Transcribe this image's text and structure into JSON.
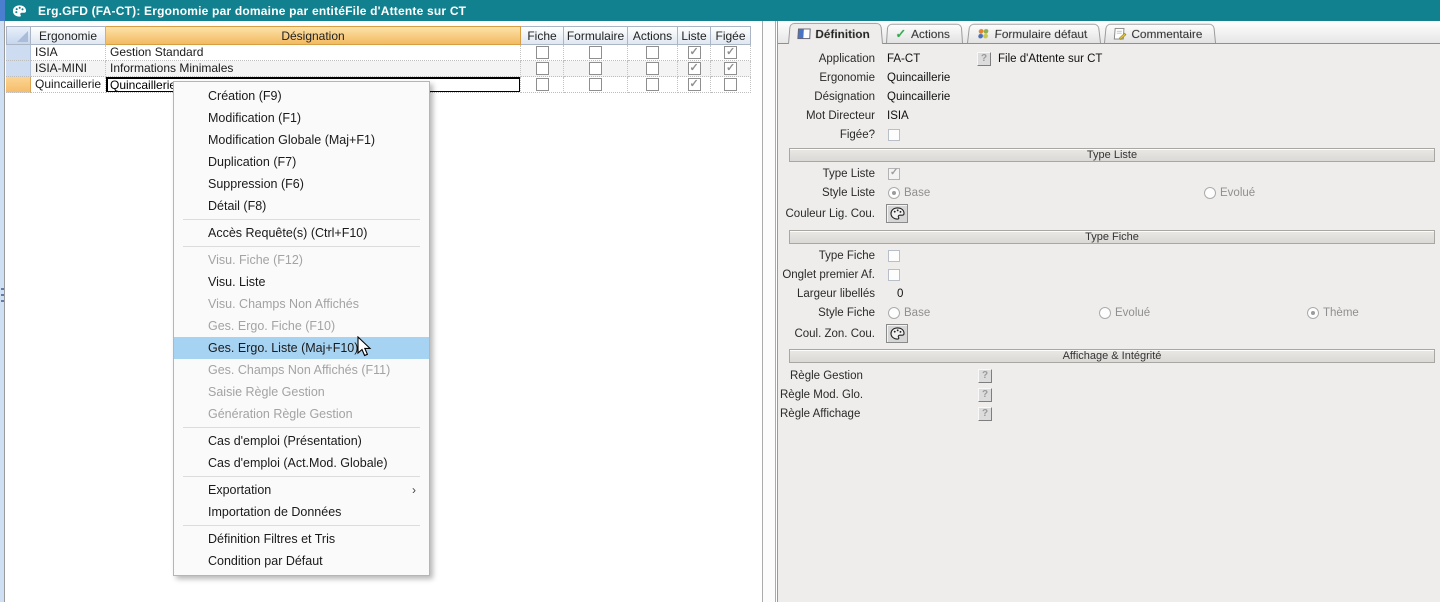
{
  "window": {
    "title": "Erg.GFD (FA-CT): Ergonomie par domaine par entitéFile d'Attente sur CT"
  },
  "colors": {
    "titlebar_teal": "#12818f",
    "sort_header_orange": "#f2ba62",
    "selector_blue": "#cddcf1",
    "current_row_orange": "#f5bd6b",
    "menu_highlight_blue": "#a7d3f2",
    "check_gray": "#8f8f8f",
    "actions_tab_check_green": "#2fa64b"
  },
  "table": {
    "headers": [
      "Ergonomie",
      "Désignation",
      "Fiche",
      "Formulaire",
      "Actions",
      "Liste",
      "Figée"
    ],
    "rows": [
      {
        "ergonomie": "ISIA",
        "designation": "Gestion Standard",
        "checks": [
          false,
          false,
          false,
          true,
          true
        ]
      },
      {
        "ergonomie": "ISIA-MINI",
        "designation": "Informations Minimales",
        "checks": [
          false,
          false,
          false,
          true,
          true
        ]
      },
      {
        "ergonomie": "Quincaillerie",
        "designation": "Quincaillerie",
        "checks": [
          false,
          false,
          false,
          true,
          false
        ],
        "editing": true,
        "current": true
      }
    ]
  },
  "context_menu": {
    "items": [
      {
        "label": "Création (F9)"
      },
      {
        "label": "Modification (F1)"
      },
      {
        "label": "Modification Globale (Maj+F1)"
      },
      {
        "label": "Duplication (F7)"
      },
      {
        "label": "Suppression (F6)"
      },
      {
        "label": "Détail (F8)"
      },
      {
        "label": "Accès Requête(s) (Ctrl+F10)"
      },
      {
        "label": "Visu. Fiche (F12)",
        "disabled": true
      },
      {
        "label": "Visu. Liste"
      },
      {
        "label": "Visu. Champs Non Affichés",
        "disabled": true
      },
      {
        "label": "Ges. Ergo. Fiche (F10)",
        "disabled": true
      },
      {
        "label": "Ges. Ergo. Liste (Maj+F10)",
        "highlighted": true
      },
      {
        "label": "Ges. Champs Non Affichés (F11)",
        "disabled": true
      },
      {
        "label": "Saisie Règle Gestion",
        "disabled": true
      },
      {
        "label": "Génération Règle Gestion",
        "disabled": true
      },
      {
        "label": "Cas d'emploi (Présentation)"
      },
      {
        "label": "Cas d'emploi (Act.Mod. Globale)"
      },
      {
        "label": "Exportation",
        "submenu": true,
        "submenu_arrow": "›"
      },
      {
        "label": "Importation de Données"
      },
      {
        "label": "Définition Filtres et Tris"
      },
      {
        "label": "Condition par Défaut"
      }
    ]
  },
  "panel": {
    "tabs": [
      {
        "label": "Définition",
        "active": true
      },
      {
        "label": "Actions"
      },
      {
        "label": "Formulaire défaut"
      },
      {
        "label": "Commentaire"
      }
    ],
    "help_glyph": "?",
    "definition": {
      "application": {
        "label": "Application",
        "value": "FA-CT",
        "desc": "File d'Attente sur CT"
      },
      "ergonomie": {
        "label": "Ergonomie",
        "value": "Quincaillerie"
      },
      "designation": {
        "label": "Désignation",
        "value": "Quincaillerie"
      },
      "mot_directeur": {
        "label": "Mot Directeur",
        "value": "ISIA"
      },
      "figee": {
        "label": "Figée?",
        "checked": false
      },
      "section_type_liste": "Type Liste",
      "type_liste": {
        "label": "Type Liste",
        "checked": true
      },
      "style_liste": {
        "label": "Style Liste",
        "options": [
          {
            "label": "Base",
            "selected": true
          },
          {
            "label": "Evolué",
            "selected": false
          }
        ]
      },
      "couleur_lig": {
        "label": "Couleur Lig. Cou."
      },
      "section_type_fiche": "Type Fiche",
      "type_fiche": {
        "label": "Type Fiche",
        "checked": false
      },
      "onglet_premier": {
        "label": "Onglet premier Af.",
        "checked": false
      },
      "largeur": {
        "label": "Largeur libellés",
        "value": "0"
      },
      "style_fiche": {
        "label": "Style Fiche",
        "options": [
          {
            "label": "Base",
            "selected": false
          },
          {
            "label": "Evolué",
            "selected": false
          },
          {
            "label": "Thème",
            "selected": true
          }
        ]
      },
      "coul_zon": {
        "label": "Coul. Zon. Cou."
      },
      "section_affichage": "Affichage & Intégrité",
      "regle_gestion": {
        "label": "Règle Gestion"
      },
      "regle_mod_glo": {
        "label": "Règle Mod. Glo."
      },
      "regle_affichage": {
        "label": "Règle Affichage"
      }
    }
  }
}
